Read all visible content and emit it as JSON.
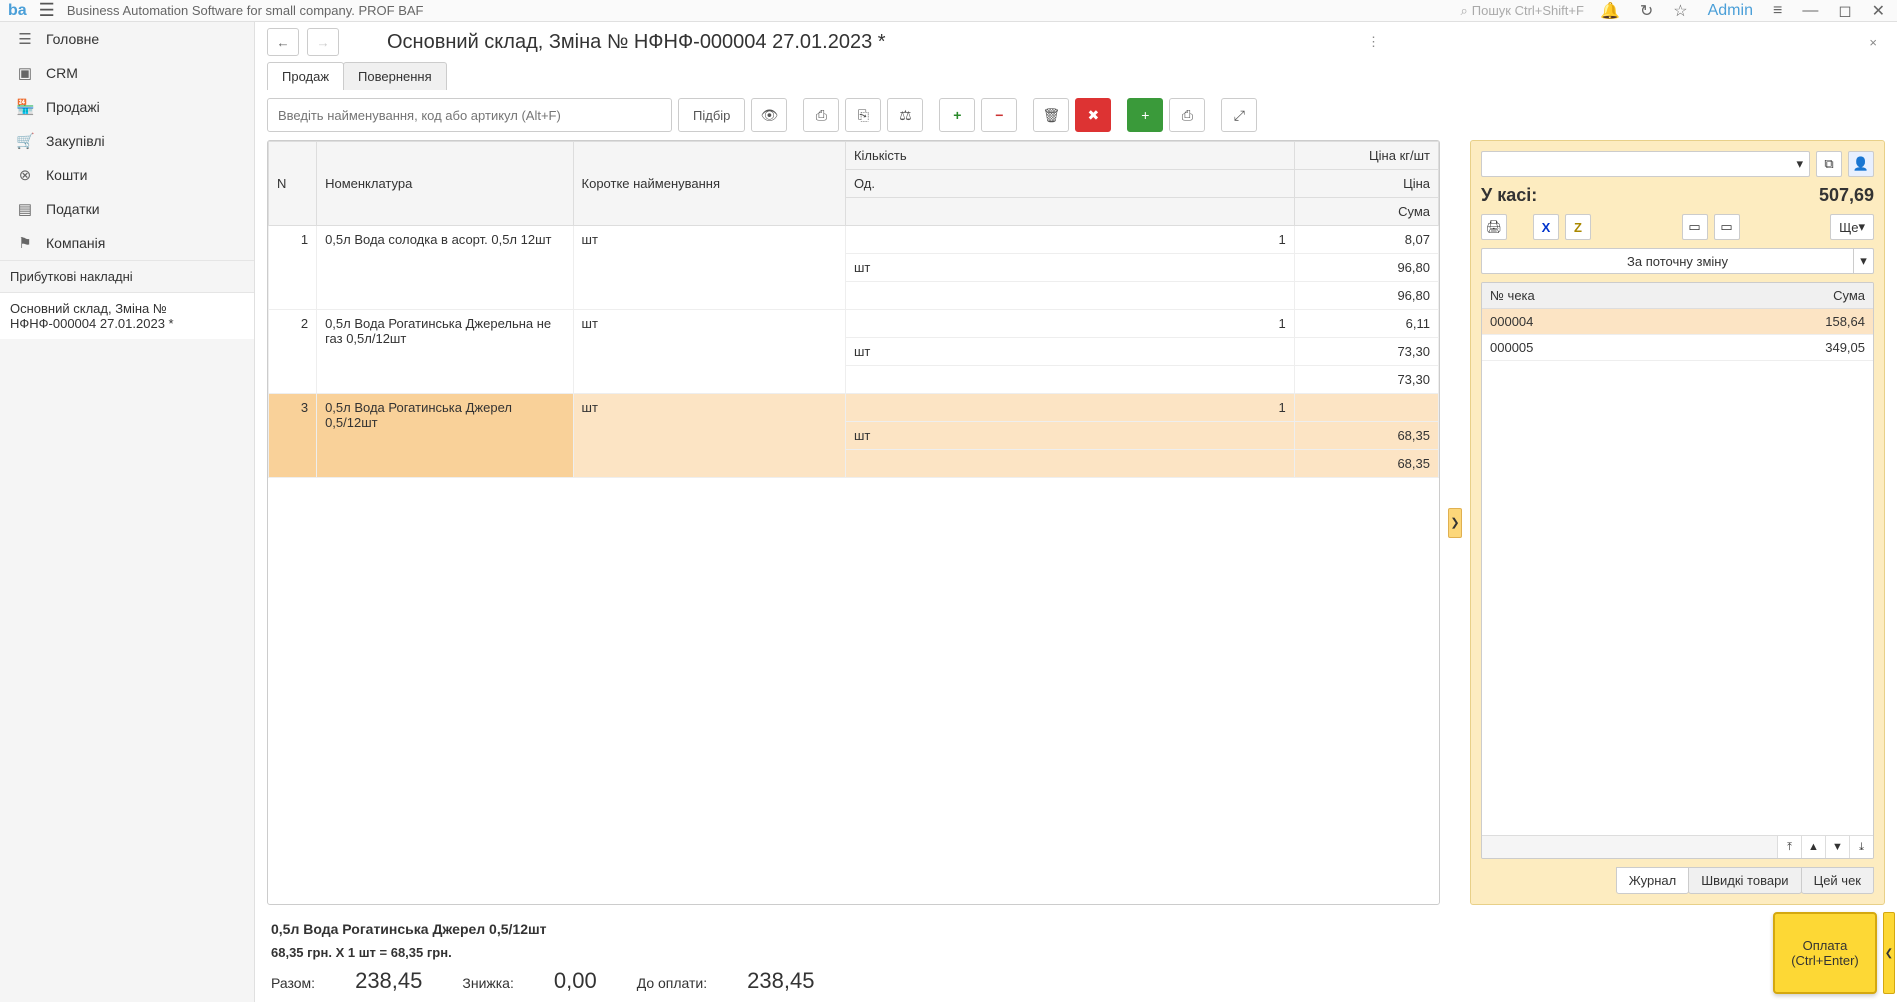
{
  "topbar": {
    "app_title": "Business Automation Software for small company. PROF BAF",
    "search_placeholder": "Пошук Ctrl+Shift+F",
    "admin": "Admin"
  },
  "sidebar": {
    "items": [
      {
        "icon": "☰",
        "label": "Головне"
      },
      {
        "icon": "▣",
        "label": "CRM"
      },
      {
        "icon": "🏪",
        "label": "Продажі"
      },
      {
        "icon": "🛒",
        "label": "Закупівлі"
      },
      {
        "icon": "⊗",
        "label": "Кошти"
      },
      {
        "icon": "▤",
        "label": "Податки"
      },
      {
        "icon": "⚑",
        "label": "Компанія"
      }
    ],
    "sub1": "Прибуткові накладні",
    "sub2": "Основний склад, Зміна № НФНФ-000004  27.01.2023 *"
  },
  "doc": {
    "title": "Основний склад, Зміна № НФНФ-000004  27.01.2023 *",
    "tabs": [
      "Продаж",
      "Повернення"
    ],
    "search_placeholder": "Введіть найменування, код або артикул (Alt+F)",
    "pick_btn": "Підбір"
  },
  "table": {
    "headers": {
      "n": "N",
      "nom": "Номенклатура",
      "short": "Коротке найменування",
      "qty": "Кількість",
      "unit": "Од.",
      "price": "Ціна кг/шт",
      "priceunit": "Ціна",
      "sum": "Сума"
    },
    "rows": [
      {
        "n": "1",
        "nom": "0,5л Вода солодка в асорт. 0,5л 12шт",
        "short": "шт",
        "qty": "1",
        "unit": "шт",
        "price": "8,07",
        "priceunit": "96,80",
        "sum": "96,80"
      },
      {
        "n": "2",
        "nom": "0,5л Вода Рогатинська Джерельна не газ 0,5л/12шт",
        "short": "шт",
        "qty": "1",
        "unit": "шт",
        "price": "6,11",
        "priceunit": "73,30",
        "sum": "73,30"
      },
      {
        "n": "3",
        "nom": "0,5л Вода Рогатинська Джерел 0,5/12шт",
        "short": "шт",
        "qty": "1",
        "unit": "шт",
        "price": "",
        "priceunit": "68,35",
        "sum": "68,35"
      }
    ]
  },
  "right": {
    "cash_label": "У касі:",
    "cash_value": "507,69",
    "more_btn": "Ще",
    "shift_label": "За поточну зміну",
    "receipts_hdr": {
      "num": "№ чека",
      "sum": "Сума"
    },
    "receipts": [
      {
        "num": "000004",
        "sum": "158,64"
      },
      {
        "num": "000005",
        "sum": "349,05"
      }
    ],
    "tabs": [
      "Журнал",
      "Швидкі товари",
      "Цей чек"
    ]
  },
  "footer": {
    "sel_name": "0,5л Вода Рогатинська Джерел 0,5/12шт",
    "sel_price": "68,35 грн. X 1 шт = 68,35 грн.",
    "total_lbl": "Разом:",
    "total_val": "238,45",
    "disc_lbl": "Знижка:",
    "disc_val": "0,00",
    "pay_lbl": "До оплати:",
    "pay_val": "238,45"
  },
  "pay_btn": {
    "l1": "Оплата",
    "l2": "(Ctrl+Enter)"
  }
}
